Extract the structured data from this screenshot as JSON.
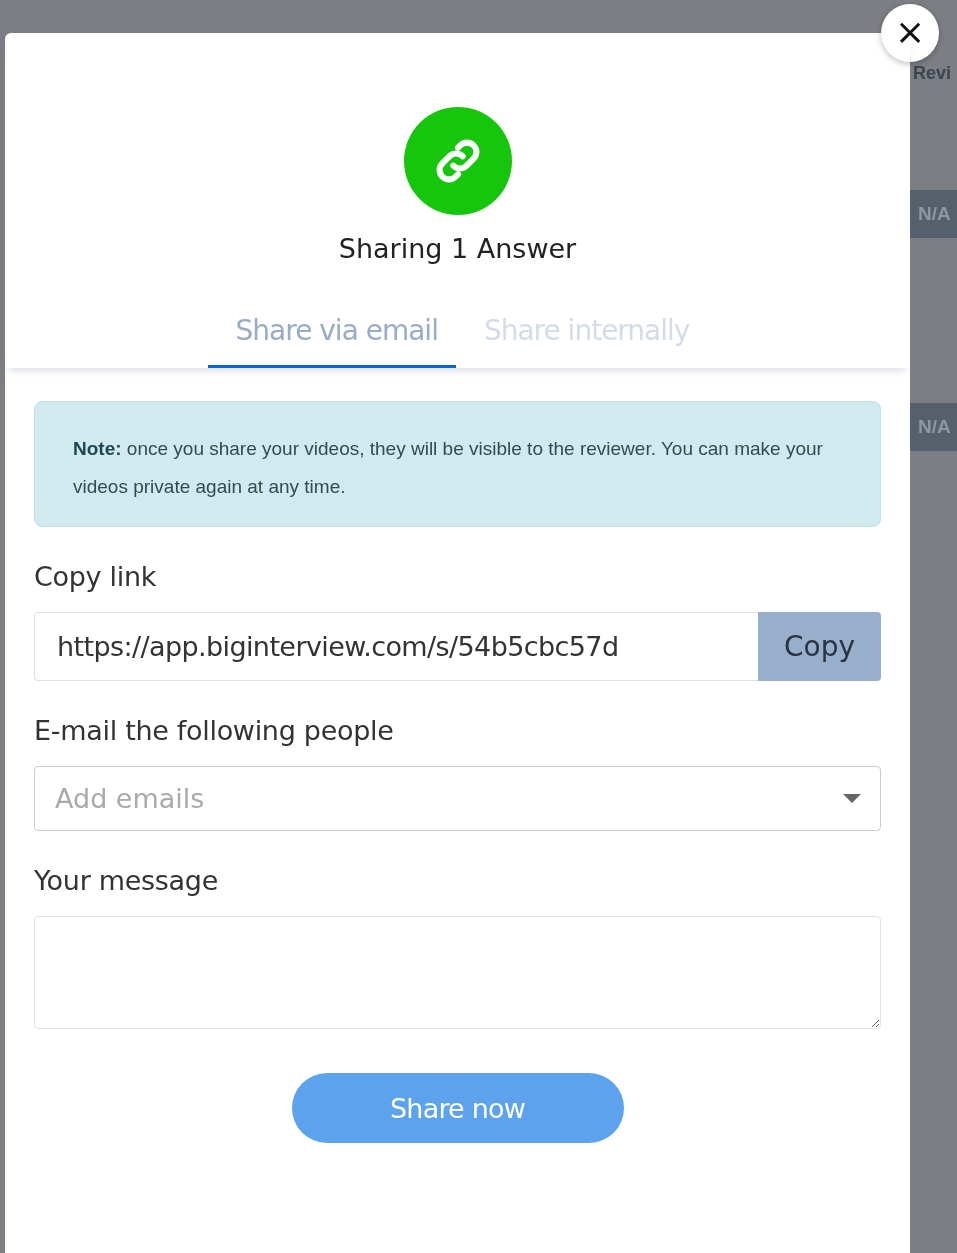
{
  "background": {
    "column_header": "Revi",
    "badges": [
      "N/A",
      "N/A"
    ]
  },
  "dialog": {
    "close": "×",
    "title": "Sharing 1 Answer",
    "tabs": [
      {
        "label": "Share via email",
        "selected": true
      },
      {
        "label": "Share internally",
        "selected": false
      }
    ],
    "note": "**Note:** once you share your videos, they will be visible to the reviewer. You can make your videos private again at any time.",
    "copy_link": {
      "label": "Copy link",
      "value": "https://app.biginterview.com/s/54b5cbc57d",
      "button": "Copy"
    },
    "emails": {
      "label": "E-mail the following people",
      "placeholder": "Add emails"
    },
    "message": {
      "label": "Your message"
    },
    "submit": "Share now"
  }
}
